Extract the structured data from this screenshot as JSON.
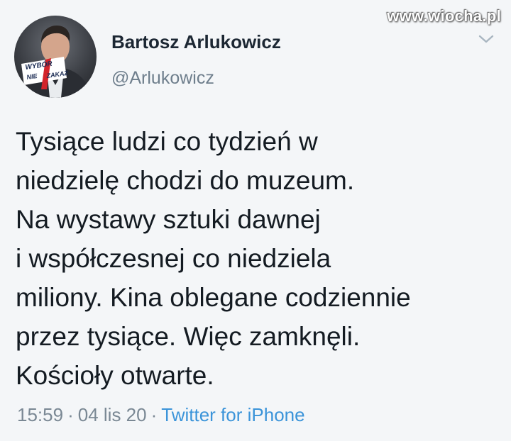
{
  "watermark": "www.wiocha.pl",
  "author": {
    "name": "Bartosz Arlukowicz",
    "handle": "@Arlukowicz",
    "avatar_badge_line1": "WYBÓR",
    "avatar_badge_line2a": "NIE",
    "avatar_badge_line2b": "ZAKAZ"
  },
  "tweet": {
    "lines": [
      "Tysiące ludzi co tydzień w",
      "niedzielę chodzi do muzeum.",
      "Na wystawy sztuki dawnej",
      "i współczesnej co niedziela",
      "miliony. Kina oblegane codziennie",
      "przez tysiące. Więc zamknęli.",
      "Kościoły otwarte."
    ]
  },
  "meta": {
    "time": "15:59",
    "date": "04 lis 20",
    "separator": "·",
    "source": "Twitter for iPhone"
  },
  "colors": {
    "background": "#f4f6f8",
    "text": "#141b22",
    "muted": "#7a8894",
    "link": "#3b94d9",
    "badge_red": "#d3232a"
  },
  "icons": {
    "menu": "chevron-down-icon"
  }
}
